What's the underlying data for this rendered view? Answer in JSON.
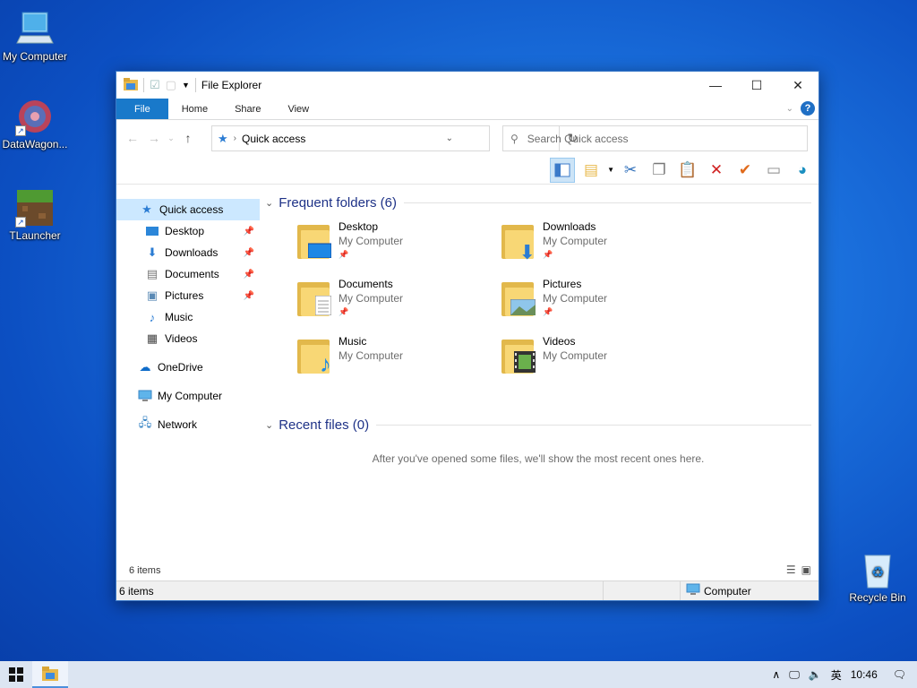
{
  "desktop": {
    "icons": [
      {
        "label": "My Computer"
      },
      {
        "label": "DataWagon..."
      },
      {
        "label": "TLauncher"
      },
      {
        "label": "Recycle Bin"
      }
    ]
  },
  "window": {
    "title": "File Explorer",
    "ribbon_tabs": [
      "File",
      "Home",
      "Share",
      "View"
    ],
    "help_label": "?",
    "address": "Quick access",
    "search_placeholder": "Search Quick access",
    "nav": [
      {
        "label": "Quick access",
        "icon": "star-icon",
        "selected": true
      },
      {
        "label": "Desktop",
        "icon": "desktop-icon",
        "pinned": true
      },
      {
        "label": "Downloads",
        "icon": "download-icon",
        "pinned": true
      },
      {
        "label": "Documents",
        "icon": "document-icon",
        "pinned": true
      },
      {
        "label": "Pictures",
        "icon": "picture-icon",
        "pinned": true
      },
      {
        "label": "Music",
        "icon": "music-icon"
      },
      {
        "label": "Videos",
        "icon": "video-icon"
      },
      {
        "label": "OneDrive",
        "icon": "cloud-icon"
      },
      {
        "label": "My Computer",
        "icon": "computer-icon"
      },
      {
        "label": "Network",
        "icon": "network-icon"
      }
    ],
    "frequent_header": "Frequent folders (6)",
    "folders": [
      {
        "name": "Desktop",
        "location": "My Computer",
        "pinned": true
      },
      {
        "name": "Downloads",
        "location": "My Computer",
        "pinned": true
      },
      {
        "name": "Documents",
        "location": "My Computer",
        "pinned": true
      },
      {
        "name": "Pictures",
        "location": "My Computer",
        "pinned": true
      },
      {
        "name": "Music",
        "location": "My Computer",
        "pinned": false
      },
      {
        "name": "Videos",
        "location": "My Computer",
        "pinned": false
      }
    ],
    "recent_header": "Recent files (0)",
    "recent_empty": "After you've opened some files, we'll show the most recent ones here.",
    "items_count": "6 items",
    "status": {
      "left": "6 items",
      "right": "Computer"
    }
  },
  "taskbar": {
    "lang": "英",
    "time": "10:46"
  },
  "colors": {
    "accent": "#1979ca",
    "header_text": "#1e3287",
    "selection": "#cce8ff"
  }
}
